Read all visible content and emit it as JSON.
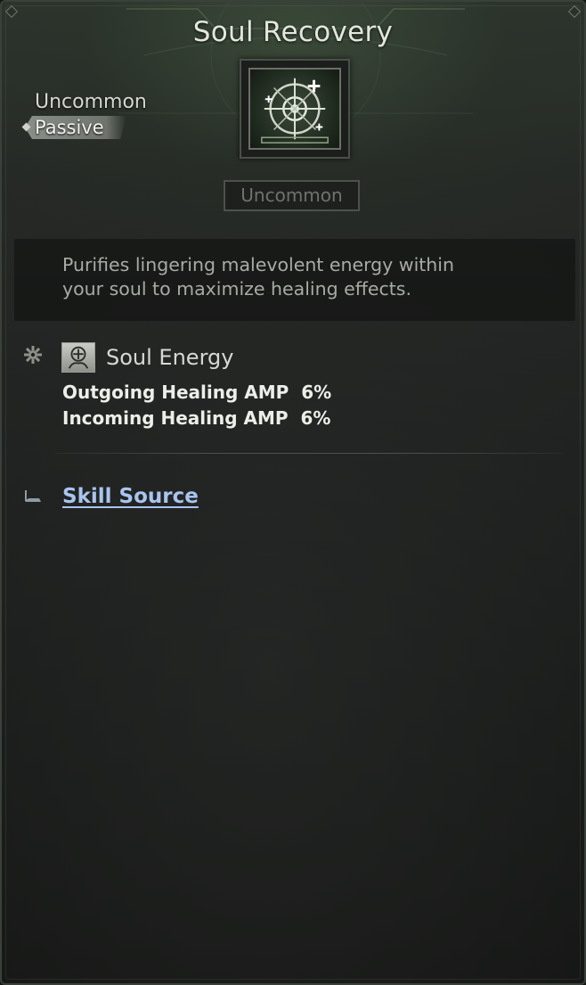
{
  "tooltip": {
    "title": "Soul Recovery",
    "rarity": "Uncommon",
    "type": "Passive",
    "icon": "soul-recovery-skill-icon",
    "grade_badge": "Uncommon",
    "description": "Purifies lingering malevolent energy within\nyour soul to maximize healing effects.",
    "effect": {
      "icon": "soul-energy-icon",
      "name": "Soul Energy",
      "stats": [
        "Outgoing Healing AMP  6%",
        "Incoming Healing AMP  6%"
      ]
    },
    "source_link": "Skill Source"
  },
  "colors": {
    "title": "#e2e6dc",
    "link": "#a9c4ef",
    "grade_badge_text": "#6e736c",
    "description_text": "#a8aba4"
  }
}
